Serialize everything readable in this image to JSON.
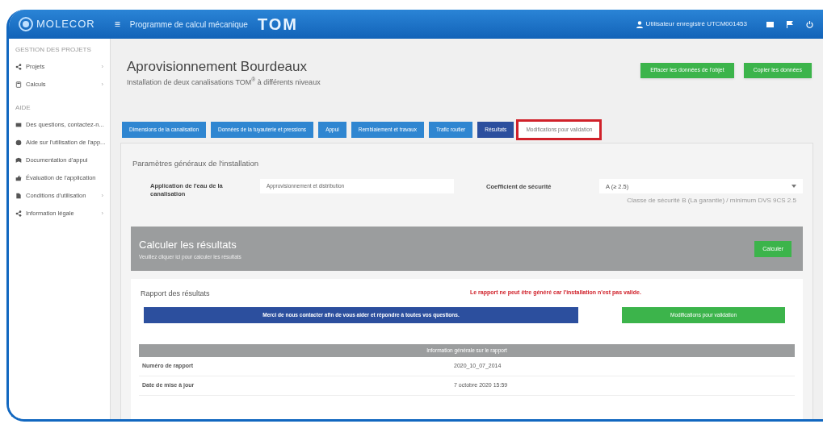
{
  "header": {
    "logo": "MOLECOR",
    "menu_icon": "≡",
    "app_title": "Programme de calcul mécanique",
    "product_logo": "TOM",
    "user": "Utilisateur enregistré UTCM001453"
  },
  "sidebar": {
    "sections": [
      {
        "title": "GESTION DES PROJETS",
        "items": [
          {
            "label": "Projets",
            "chevron": "›"
          },
          {
            "label": "Calculs",
            "chevron": "›"
          }
        ]
      },
      {
        "title": "AIDE",
        "items": [
          {
            "label": "Des questions, contactez-n..."
          },
          {
            "label": "Aide sur l'utilisation de l'app..."
          },
          {
            "label": "Documentation d'appui"
          },
          {
            "label": "Évaluation de l'application"
          },
          {
            "label": "Conditions d'utilisation",
            "chevron": "›"
          },
          {
            "label": "Information légale",
            "chevron": "›"
          }
        ]
      }
    ]
  },
  "page": {
    "title": "Aprovisionnement Bourdeaux",
    "subtitle": "Installation de deux canalisations TOM$^{®}$ à différents niveaux",
    "actions": [
      "Effacer les données de l'objet",
      "Copier les données"
    ]
  },
  "tabs": [
    {
      "label": "Dimensions de la canalisation",
      "selected": false,
      "highlighted": false
    },
    {
      "label": "Données de la tuyauterie et pressions",
      "selected": false,
      "highlighted": false
    },
    {
      "label": "Appui",
      "selected": false,
      "highlighted": false
    },
    {
      "label": "Remblaiement et travaux",
      "selected": false,
      "highlighted": false
    },
    {
      "label": "Trafic routier",
      "selected": false,
      "highlighted": false
    },
    {
      "label": "Résultats",
      "selected": true,
      "highlighted": false
    },
    {
      "label": "Modifications pour validation",
      "selected": false,
      "highlighted": true
    }
  ],
  "params": {
    "title": "Paramètres généraux de l'installation",
    "application_label": "Application de l'eau de la canalisation",
    "application_value": "Approvisionnement et distribution",
    "coefficient_label": "Coefficient de sécurité",
    "coefficient_value": "A (≥ 2.5)",
    "coefficient_hint": "Classe de sécurité B (La garantie) / minimum DVS 9CS 2.5"
  },
  "calculate": {
    "title": "Calculer les résultats",
    "subtitle": "Veuillez cliquer ici pour calculer les résultats",
    "button": "Calculer"
  },
  "report": {
    "title": "Rapport des résultats",
    "error": "Le rapport ne peut être généré car l'installation n'est pas valide.",
    "contact": "Merci de nous contacter afin de vous aider et répondre à toutes vos questions.",
    "validation_button": "Modifications pour validation",
    "info_header": "Information générale sur le rapport",
    "rows": [
      {
        "label": "Numéro de rapport",
        "value": "2020_10_07_2014"
      },
      {
        "label": "Date de mise à jour",
        "value": "7 octobre 2020 15:59"
      }
    ]
  }
}
